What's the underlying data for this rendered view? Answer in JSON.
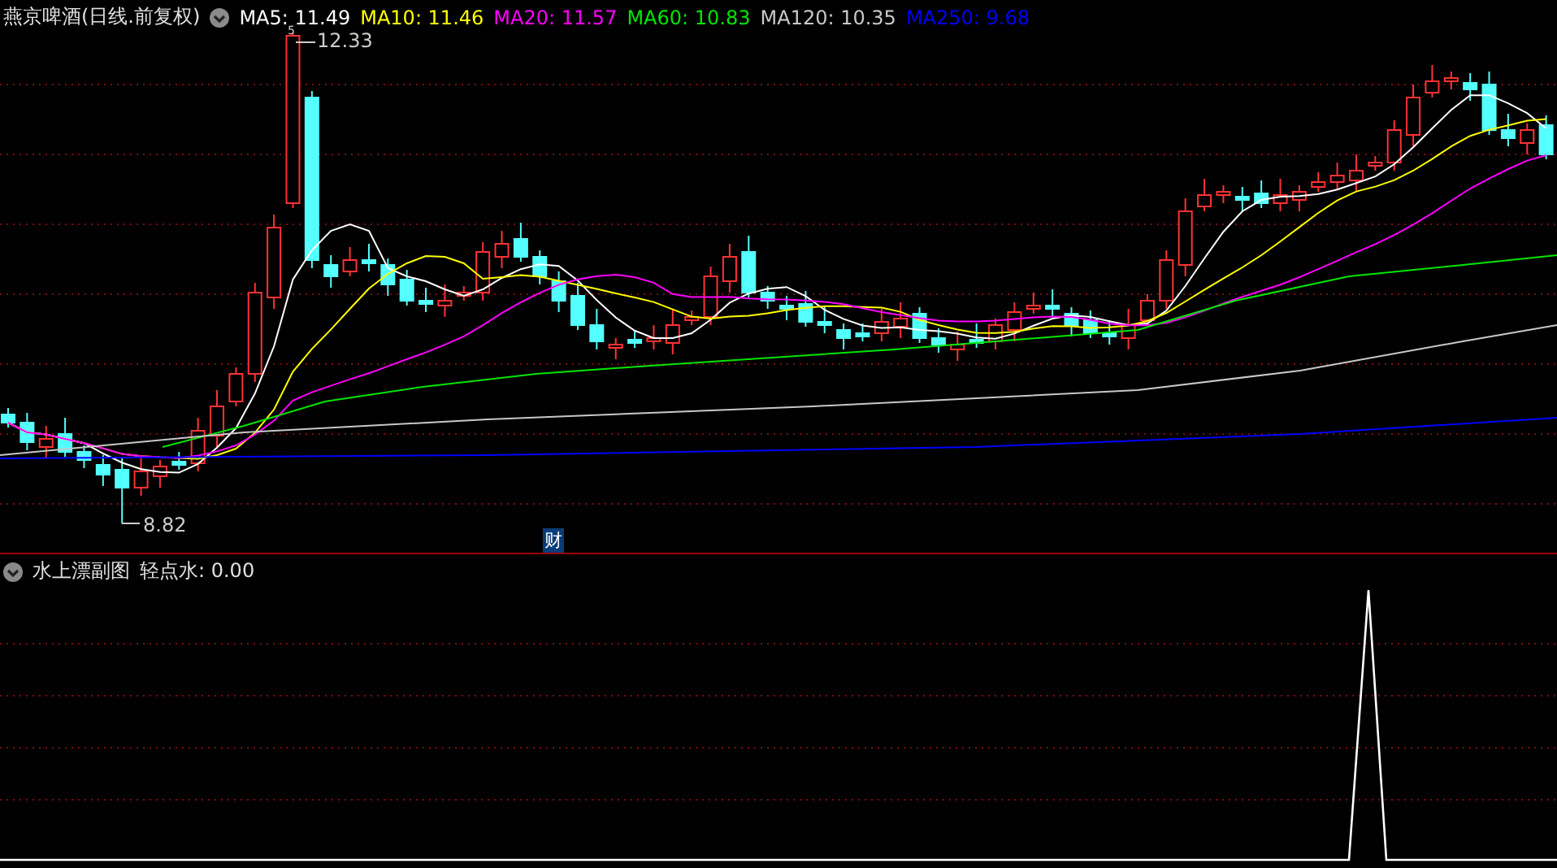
{
  "main_chart": {
    "title": "燕京啤酒(日线.前复权)",
    "moving_averages": [
      {
        "label": "MA5: 11.49",
        "color": "#ffffff"
      },
      {
        "label": "MA10: 11.46",
        "color": "#ffff00"
      },
      {
        "label": "MA20: 11.57",
        "color": "#ff00ff"
      },
      {
        "label": "MA60: 10.83",
        "color": "#00e600"
      },
      {
        "label": "MA120: 10.35",
        "color": "#c8c8c8"
      },
      {
        "label": "MA250: 9.68",
        "color": "#0000ff"
      }
    ],
    "high_mark": "5",
    "high_label": "12.33",
    "low_label": "8.82",
    "event_badge": "财"
  },
  "sub_chart": {
    "title": "水上漂副图",
    "indicator": "轻点水: 0.00"
  }
}
